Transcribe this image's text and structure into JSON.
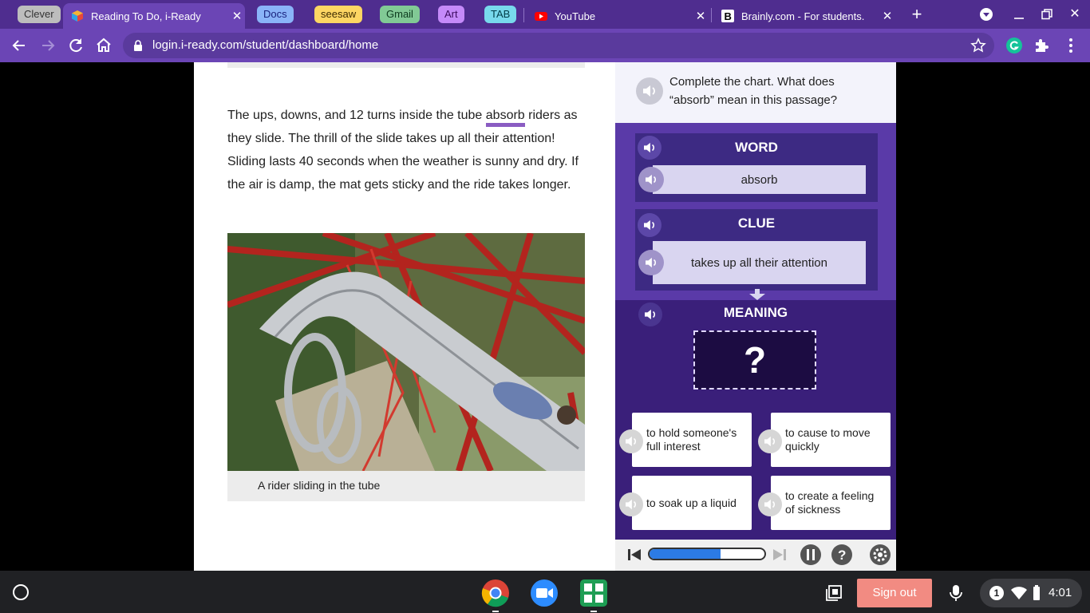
{
  "browser": {
    "tab_groups": [
      {
        "label": "Clever",
        "bg": "#bdbdbd",
        "fg": "#333333"
      },
      {
        "label": "Docs",
        "bg": "#8ab4f8",
        "fg": "#1a237e"
      },
      {
        "label": "seesaw",
        "bg": "#fdd663",
        "fg": "#3c2a00"
      },
      {
        "label": "Gmail",
        "bg": "#81c995",
        "fg": "#0d3b1e"
      },
      {
        "label": "Art",
        "bg": "#c58af9",
        "fg": "#3b0a5e"
      },
      {
        "label": "TAB",
        "bg": "#78d9ec",
        "fg": "#003c48"
      }
    ],
    "tabs": [
      {
        "title": "Reading To Do, i-Ready",
        "active": true,
        "icon": "iready-cube-icon"
      },
      {
        "title": "YouTube",
        "active": false,
        "icon": "youtube-icon"
      },
      {
        "title": "Brainly.com - For students.",
        "active": false,
        "icon": "brainly-icon"
      }
    ],
    "url": "login.i-ready.com/student/dashboard/home"
  },
  "passage": {
    "before": "The ups, downs, and 12 turns inside the tube ",
    "highlight": "absorb",
    "after": " riders as they slide. The thrill of the slide takes up all their attention! Sliding lasts 40 seconds when the weather is sunny and dry. If the air is damp, the mat gets sticky and the ride takes longer."
  },
  "photo_caption": "A rider sliding in the tube",
  "activity": {
    "question": "Complete the chart. What does “absorb” mean in this passage?",
    "word_title": "WORD",
    "word_value": "absorb",
    "clue_title": "CLUE",
    "clue_value": "takes up all their attention",
    "meaning_title": "MEANING",
    "meaning_placeholder": "?",
    "choices": [
      "to hold someone's full interest",
      "to cause to move quickly",
      "to soak up a liquid",
      "to create a feeling of sickness"
    ],
    "progress_fraction": 0.62
  },
  "shelf": {
    "signout_label": "Sign out",
    "notification_count": "1",
    "time": "4:01"
  },
  "colors": {
    "chrome_frame": "#4f2d8f",
    "panel_dark": "#3a1f7a",
    "accent": "#8a5cc2",
    "progress": "#2c7be5",
    "signout": "#f28b82"
  }
}
